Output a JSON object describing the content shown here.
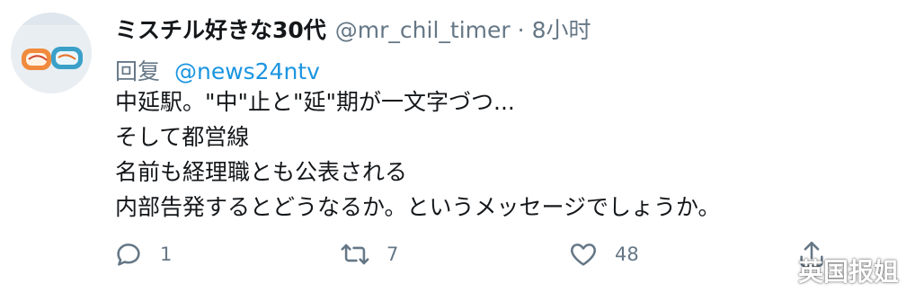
{
  "tweet": {
    "display_name": "ミスチル好きな30代",
    "handle": "@mr_chil_timer",
    "separator": "·",
    "time": "8小时",
    "reply_prefix": "回复",
    "reply_to": "@news24ntv",
    "lines": [
      "中延駅。\"中\"止と\"延\"期が一文字づつ...",
      "そして都営線",
      "名前も経理職とも公表される",
      "内部告発するとどうなるか。というメッセージでしょうか。"
    ]
  },
  "actions": {
    "reply_count": "1",
    "retweet_count": "7",
    "like_count": "48"
  },
  "watermark": {
    "text": "英国报姐",
    "icon": "wechat-icon"
  },
  "colors": {
    "link": "#1b95e0",
    "muted": "#657786",
    "text": "#14171a"
  }
}
